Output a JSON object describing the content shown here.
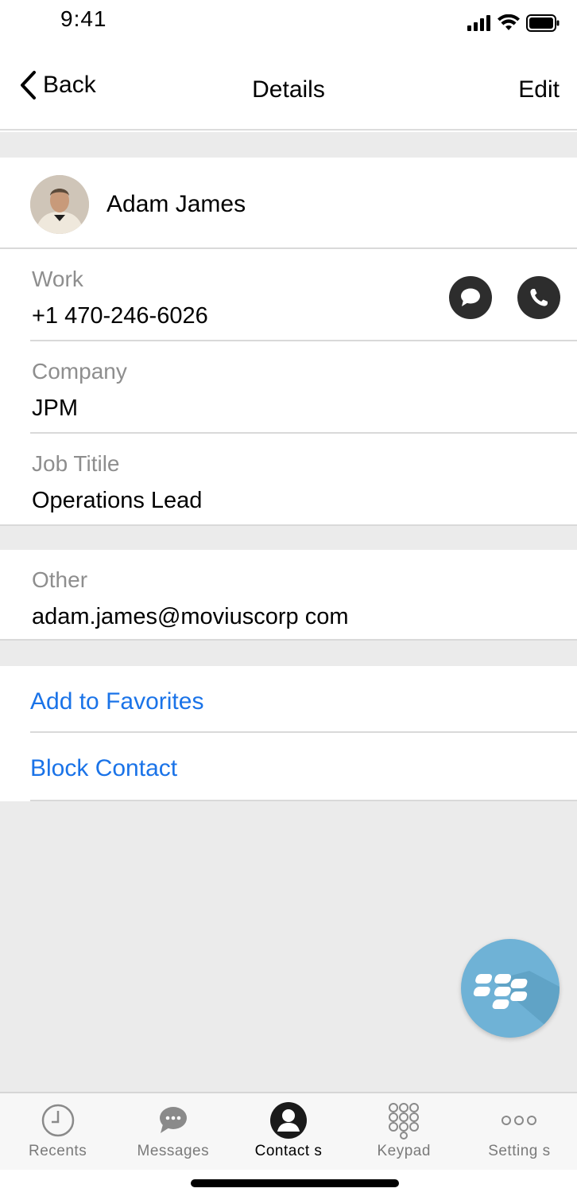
{
  "status_bar": {
    "time": "9:41",
    "icons": [
      "signal-icon",
      "wifi-icon",
      "battery-icon"
    ]
  },
  "nav": {
    "back_label": "Back",
    "title": "Details",
    "edit_label": "Edit"
  },
  "contact": {
    "name": "Adam James"
  },
  "fields": {
    "work": {
      "label": "Work",
      "value": "+1 470-246-6026"
    },
    "company": {
      "label": "Company",
      "value": "JPM"
    },
    "job_title": {
      "label": "Job Titile",
      "value": "Operations Lead"
    },
    "other": {
      "label": "Other",
      "value": "adam.james@moviuscorp com"
    }
  },
  "actions": {
    "add_favorites": "Add to Favorites",
    "block_contact": "Block Contact"
  },
  "tabs": [
    {
      "label": "Recents",
      "icon": "clock-icon"
    },
    {
      "label": "Messages",
      "icon": "chat-bubble-icon"
    },
    {
      "label": "Contact s",
      "icon": "person-icon",
      "active": true
    },
    {
      "label": "Keypad",
      "icon": "keypad-icon"
    },
    {
      "label": "Setting s",
      "icon": "more-dots-icon"
    }
  ],
  "colors": {
    "link": "#1a73e8",
    "section_gap": "#ebebeb",
    "fab": "#6fb2d6",
    "icon_dark": "#2d2d2d"
  }
}
